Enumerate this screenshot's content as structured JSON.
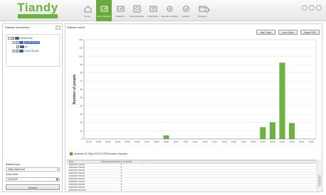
{
  "app": {
    "logo_text": "Tiandy",
    "logo_tagline": ""
  },
  "nav": {
    "items": [
      {
        "label": "Home",
        "icon": "house-icon",
        "active": false
      },
      {
        "label": "Face Statistics",
        "icon": "face-chart-icon",
        "active": true
      },
      {
        "label": "Statistics",
        "icon": "bar-chart-icon",
        "active": false
      },
      {
        "label": "Face Detection",
        "icon": "face-detect-icon",
        "active": false
      },
      {
        "label": "Information",
        "icon": "info-icon",
        "active": false
      },
      {
        "label": "Operation Setting",
        "icon": "settings-icon",
        "active": false
      },
      {
        "label": "Solution",
        "icon": "solution-icon",
        "active": false
      },
      {
        "label": "Structure",
        "icon": "structure-icon",
        "active": false
      }
    ]
  },
  "left_panel": {
    "title": "Statistic information",
    "tree": [
      {
        "label": "Device tree",
        "level": 0,
        "toggle": "-",
        "selected": false
      },
      {
        "label": "10.30.33.101",
        "level": 1,
        "toggle": "-",
        "selected": true
      },
      {
        "label": "ch",
        "level": 2,
        "toggle": "",
        "selected": false
      },
      {
        "label": "10.30.33.102",
        "level": 1,
        "toggle": "+",
        "selected": false
      }
    ],
    "stat_type_label": "Statistic type",
    "stat_type_value": "Daily statement",
    "select_time_label": "Select time",
    "select_time_value": "2016/3/9",
    "search_label": "Search"
  },
  "result": {
    "title": "Statistic result",
    "buttons": [
      "Bar Chart",
      "Line Chart",
      "Export XLS"
    ],
    "legend": "Detected ID:Total 19:30:13:38 Number of people"
  },
  "chart_data": {
    "type": "bar",
    "ylabel": "Number of people",
    "xlabel": "",
    "ylim": [
      0,
      120
    ],
    "yticks": [
      0,
      10,
      20,
      30,
      40,
      50,
      60,
      70,
      80,
      90,
      100,
      110,
      120
    ],
    "categories": [
      "01:00",
      "02:00",
      "03:00",
      "04:00",
      "05:00",
      "06:00",
      "07:00",
      "08:00",
      "09:00",
      "10:00",
      "11:00",
      "12:00",
      "13:00",
      "14:00",
      "15:00",
      "16:00",
      "17:00",
      "18:00",
      "19:00",
      "20:00",
      "21:00",
      "22:00",
      "23:00",
      "24:00"
    ],
    "values": [
      0,
      0,
      0,
      0,
      0,
      0,
      0,
      0,
      4,
      0,
      0,
      0,
      0,
      0,
      0,
      0,
      0,
      0,
      14,
      20,
      92,
      19,
      0,
      0
    ],
    "color": "#6db33f"
  },
  "table": {
    "columns": [
      "Time",
      "Detected information / Amounts"
    ],
    "rows": [
      [
        "2016/3/9 1:00:00",
        "0"
      ],
      [
        "2016/3/9 2:00:00",
        "0"
      ],
      [
        "2016/3/9 3:00:00",
        "0"
      ],
      [
        "2016/3/9 4:00:00",
        "0"
      ],
      [
        "2016/3/9 5:00:00",
        "0"
      ],
      [
        "2016/3/9 6:00:00",
        "0"
      ],
      [
        "2016/3/9 7:00:00",
        "0"
      ],
      [
        "2016/3/9 8:00:00",
        "0"
      ],
      [
        "2016/3/9 9:00:00",
        "4"
      ],
      [
        "2016/3/9 10:00:00",
        "0"
      ],
      [
        "2016/3/9 19:00:00",
        "14"
      ],
      [
        "2016/3/9 20:00:00",
        "20"
      ],
      [
        "2016/3/9 21:00:00",
        "92"
      ],
      [
        "2016/3/9 22:00:00",
        "19"
      ]
    ]
  }
}
